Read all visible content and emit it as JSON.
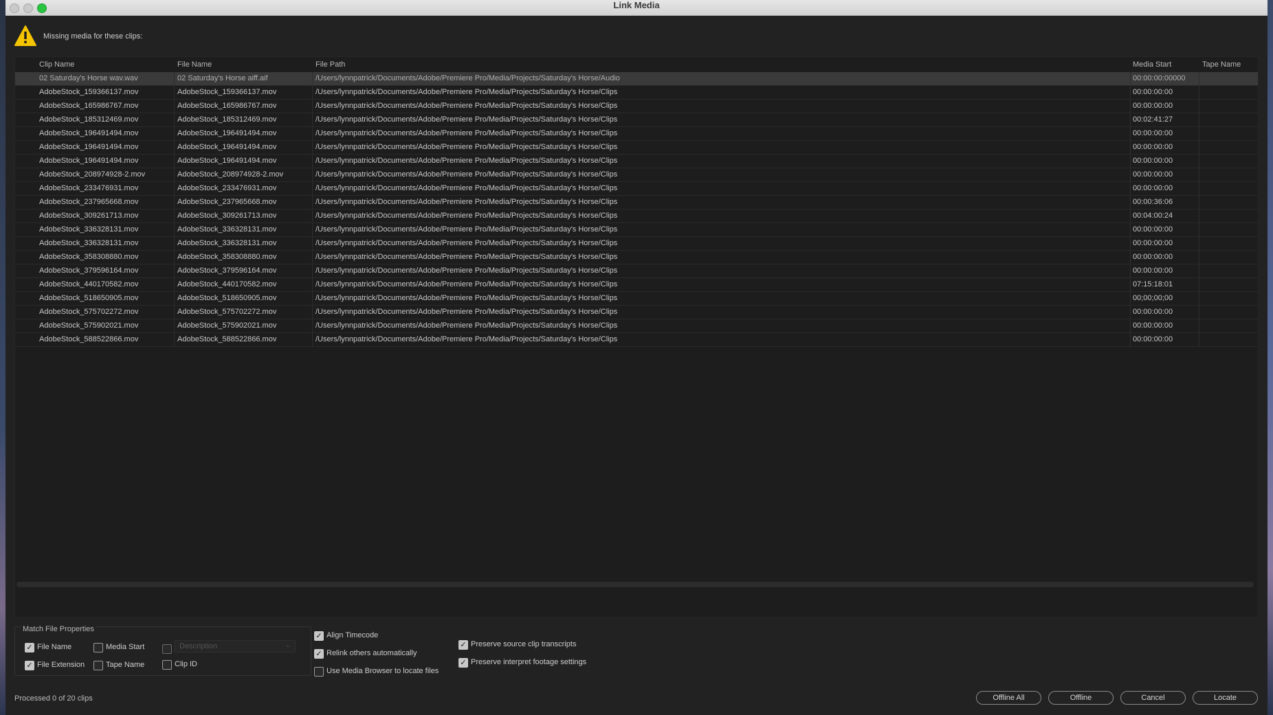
{
  "window": {
    "title": "Link Media"
  },
  "warning": {
    "icon": "warning-icon",
    "text": "Missing media for these clips:",
    "color": "#f5c400"
  },
  "table": {
    "columns": [
      "Clip Name",
      "File Name",
      "File Path",
      "Media Start",
      "Tape Name"
    ],
    "rows": [
      {
        "clip": "02 Saturday's Horse  wav.wav",
        "file": "02 Saturday's Horse aiff.aif",
        "path": "/Users/lynnpatrick/Documents/Adobe/Premiere Pro/Media/Projects/Saturday's Horse/Audio",
        "start": "00:00:00:00000",
        "tape": ""
      },
      {
        "clip": "AdobeStock_159366137.mov",
        "file": "AdobeStock_159366137.mov",
        "path": "/Users/lynnpatrick/Documents/Adobe/Premiere Pro/Media/Projects/Saturday's Horse/Clips",
        "start": "00:00:00:00",
        "tape": ""
      },
      {
        "clip": "AdobeStock_165986767.mov",
        "file": "AdobeStock_165986767.mov",
        "path": "/Users/lynnpatrick/Documents/Adobe/Premiere Pro/Media/Projects/Saturday's Horse/Clips",
        "start": "00:00:00:00",
        "tape": ""
      },
      {
        "clip": "AdobeStock_185312469.mov",
        "file": "AdobeStock_185312469.mov",
        "path": "/Users/lynnpatrick/Documents/Adobe/Premiere Pro/Media/Projects/Saturday's Horse/Clips",
        "start": "00:02:41:27",
        "tape": ""
      },
      {
        "clip": "AdobeStock_196491494.mov",
        "file": "AdobeStock_196491494.mov",
        "path": "/Users/lynnpatrick/Documents/Adobe/Premiere Pro/Media/Projects/Saturday's Horse/Clips",
        "start": "00:00:00:00",
        "tape": ""
      },
      {
        "clip": "AdobeStock_196491494.mov",
        "file": "AdobeStock_196491494.mov",
        "path": "/Users/lynnpatrick/Documents/Adobe/Premiere Pro/Media/Projects/Saturday's Horse/Clips",
        "start": "00:00:00:00",
        "tape": ""
      },
      {
        "clip": "AdobeStock_196491494.mov",
        "file": "AdobeStock_196491494.mov",
        "path": "/Users/lynnpatrick/Documents/Adobe/Premiere Pro/Media/Projects/Saturday's Horse/Clips",
        "start": "00:00:00:00",
        "tape": ""
      },
      {
        "clip": "AdobeStock_208974928-2.mov",
        "file": "AdobeStock_208974928-2.mov",
        "path": "/Users/lynnpatrick/Documents/Adobe/Premiere Pro/Media/Projects/Saturday's Horse/Clips",
        "start": "00:00:00:00",
        "tape": ""
      },
      {
        "clip": "AdobeStock_233476931.mov",
        "file": "AdobeStock_233476931.mov",
        "path": "/Users/lynnpatrick/Documents/Adobe/Premiere Pro/Media/Projects/Saturday's Horse/Clips",
        "start": "00:00:00:00",
        "tape": ""
      },
      {
        "clip": "AdobeStock_237965668.mov",
        "file": "AdobeStock_237965668.mov",
        "path": "/Users/lynnpatrick/Documents/Adobe/Premiere Pro/Media/Projects/Saturday's Horse/Clips",
        "start": "00:00:36:06",
        "tape": ""
      },
      {
        "clip": "AdobeStock_309261713.mov",
        "file": "AdobeStock_309261713.mov",
        "path": "/Users/lynnpatrick/Documents/Adobe/Premiere Pro/Media/Projects/Saturday's Horse/Clips",
        "start": "00:04:00:24",
        "tape": ""
      },
      {
        "clip": "AdobeStock_336328131.mov",
        "file": "AdobeStock_336328131.mov",
        "path": "/Users/lynnpatrick/Documents/Adobe/Premiere Pro/Media/Projects/Saturday's Horse/Clips",
        "start": "00:00:00:00",
        "tape": ""
      },
      {
        "clip": "AdobeStock_336328131.mov",
        "file": "AdobeStock_336328131.mov",
        "path": "/Users/lynnpatrick/Documents/Adobe/Premiere Pro/Media/Projects/Saturday's Horse/Clips",
        "start": "00:00:00:00",
        "tape": ""
      },
      {
        "clip": "AdobeStock_358308880.mov",
        "file": "AdobeStock_358308880.mov",
        "path": "/Users/lynnpatrick/Documents/Adobe/Premiere Pro/Media/Projects/Saturday's Horse/Clips",
        "start": "00:00:00:00",
        "tape": ""
      },
      {
        "clip": "AdobeStock_379596164.mov",
        "file": "AdobeStock_379596164.mov",
        "path": "/Users/lynnpatrick/Documents/Adobe/Premiere Pro/Media/Projects/Saturday's Horse/Clips",
        "start": "00:00:00:00",
        "tape": ""
      },
      {
        "clip": "AdobeStock_440170582.mov",
        "file": "AdobeStock_440170582.mov",
        "path": "/Users/lynnpatrick/Documents/Adobe/Premiere Pro/Media/Projects/Saturday's Horse/Clips",
        "start": "07:15:18:01",
        "tape": ""
      },
      {
        "clip": "AdobeStock_518650905.mov",
        "file": "AdobeStock_518650905.mov",
        "path": "/Users/lynnpatrick/Documents/Adobe/Premiere Pro/Media/Projects/Saturday's Horse/Clips",
        "start": "00;00;00;00",
        "tape": ""
      },
      {
        "clip": "AdobeStock_575702272.mov",
        "file": "AdobeStock_575702272.mov",
        "path": "/Users/lynnpatrick/Documents/Adobe/Premiere Pro/Media/Projects/Saturday's Horse/Clips",
        "start": "00:00:00:00",
        "tape": ""
      },
      {
        "clip": "AdobeStock_575902021.mov",
        "file": "AdobeStock_575902021.mov",
        "path": "/Users/lynnpatrick/Documents/Adobe/Premiere Pro/Media/Projects/Saturday's Horse/Clips",
        "start": "00:00:00:00",
        "tape": ""
      },
      {
        "clip": "AdobeStock_588522866.mov",
        "file": "AdobeStock_588522866.mov",
        "path": "/Users/lynnpatrick/Documents/Adobe/Premiere Pro/Media/Projects/Saturday's Horse/Clips",
        "start": "00:00:00:00",
        "tape": ""
      }
    ],
    "selected_row": 0
  },
  "match_props": {
    "title": "Match File Properties",
    "file_name": {
      "label": "File Name",
      "checked": true
    },
    "media_start": {
      "label": "Media Start",
      "checked": false
    },
    "description": {
      "label": "Description",
      "checked": false,
      "enabled": false
    },
    "file_extension": {
      "label": "File Extension",
      "checked": true
    },
    "tape_name": {
      "label": "Tape Name",
      "checked": false
    },
    "clip_id": {
      "label": "Clip ID",
      "checked": false
    }
  },
  "options": {
    "align_timecode": {
      "label": "Align Timecode",
      "checked": true
    },
    "relink_auto": {
      "label": "Relink others automatically",
      "checked": true
    },
    "use_media_browser": {
      "label": "Use Media Browser to locate files",
      "checked": false
    },
    "preserve_transcripts": {
      "label": "Preserve source clip transcripts",
      "checked": true
    },
    "preserve_interpret": {
      "label": "Preserve interpret footage settings",
      "checked": true
    }
  },
  "status": "Processed 0 of 20 clips",
  "buttons": {
    "offline_all": "Offline All",
    "offline": "Offline",
    "cancel": "Cancel",
    "locate": "Locate"
  }
}
